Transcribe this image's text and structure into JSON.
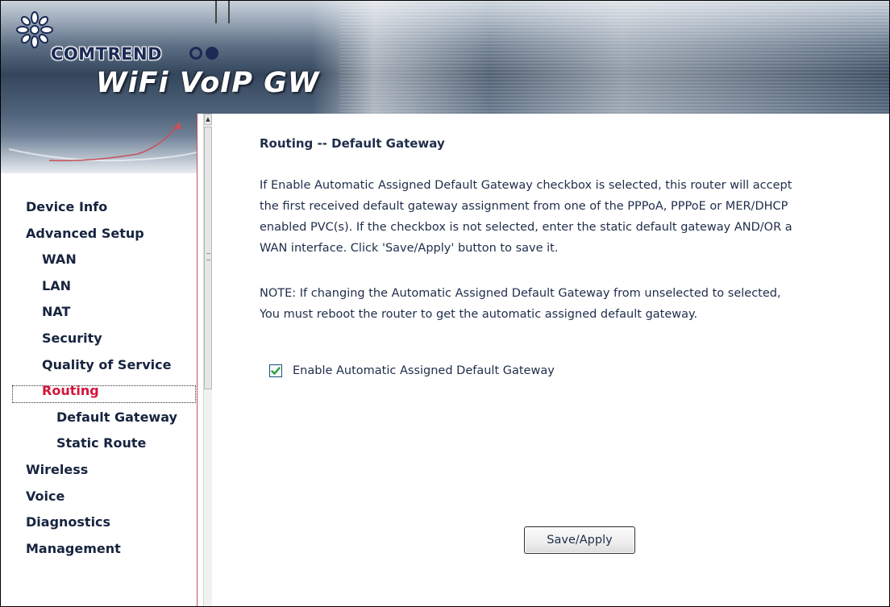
{
  "brand": {
    "company": "COMTREND",
    "product": "WiFi VoIP GW"
  },
  "nav": {
    "items": [
      {
        "label": "Device Info",
        "level": 0
      },
      {
        "label": "Advanced Setup",
        "level": 0
      },
      {
        "label": "WAN",
        "level": 1
      },
      {
        "label": "LAN",
        "level": 1
      },
      {
        "label": "NAT",
        "level": 1
      },
      {
        "label": "Security",
        "level": 1
      },
      {
        "label": "Quality of Service",
        "level": 1
      },
      {
        "label": "Routing",
        "level": 1,
        "active": true
      },
      {
        "label": "Default Gateway",
        "level": 2
      },
      {
        "label": "Static Route",
        "level": 2
      },
      {
        "label": "Wireless",
        "level": 0
      },
      {
        "label": "Voice",
        "level": 0
      },
      {
        "label": "Diagnostics",
        "level": 0
      },
      {
        "label": "Management",
        "level": 0
      }
    ]
  },
  "main": {
    "title": "Routing -- Default Gateway",
    "description_lines": [
      "If Enable Automatic Assigned Default Gateway checkbox is selected, this router will accept",
      "the first received default gateway assignment from one of the PPPoA, PPPoE or MER/DHCP",
      "enabled PVC(s). If the checkbox is not selected, enter the static default gateway AND/OR a",
      "WAN interface. Click 'Save/Apply' button to save it."
    ],
    "note_lines": [
      "NOTE: If changing the Automatic Assigned Default Gateway from unselected to selected,",
      "You must reboot the router to get the automatic assigned default gateway."
    ],
    "auto_gateway_checkbox": {
      "label": "Enable Automatic Assigned Default Gateway",
      "checked": true
    },
    "save_button_label": "Save/Apply"
  },
  "colors": {
    "nav_text": "#17243f",
    "nav_active": "#d4143c",
    "body_text": "#1f2d4a",
    "checkmark": "#2e9e3a"
  }
}
